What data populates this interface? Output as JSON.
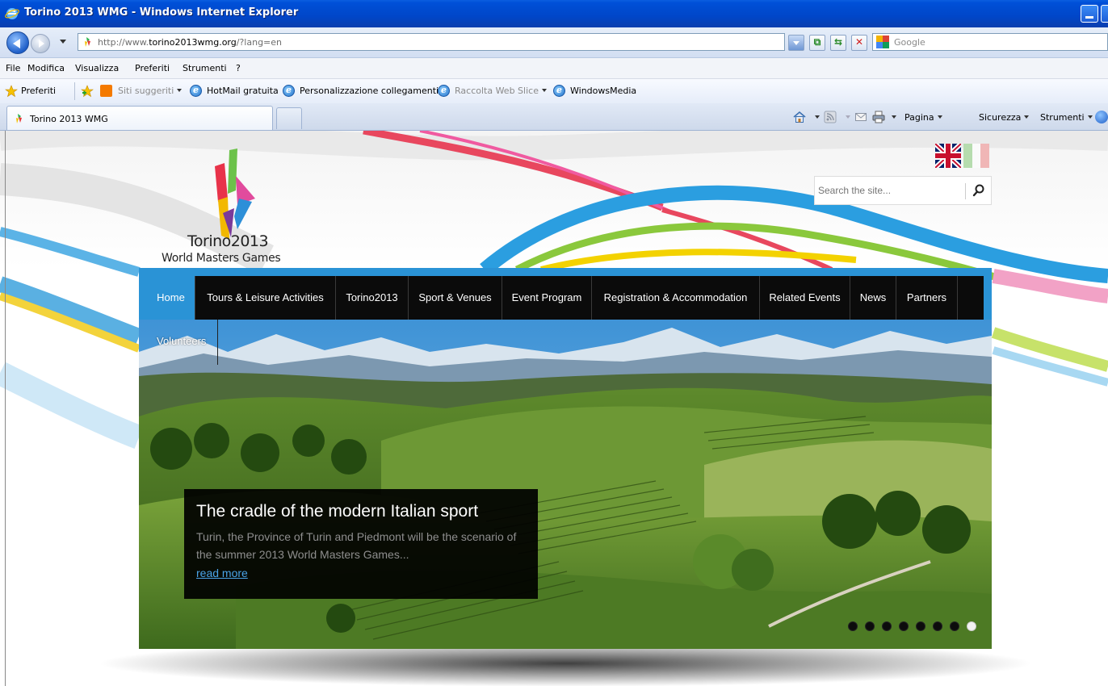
{
  "window": {
    "title": "Torino 2013 WMG - Windows Internet Explorer"
  },
  "address": {
    "url_prefix": "http://www.",
    "url_domain": "torino2013wmg.org",
    "url_suffix": "/?lang=en",
    "search_placeholder": "Google"
  },
  "menu": {
    "items": [
      "File",
      "Modifica",
      "Visualizza",
      "Preferiti",
      "Strumenti",
      "?"
    ]
  },
  "favorites": {
    "label": "Preferiti",
    "items": [
      {
        "label": "Siti suggeriti",
        "dimmed": true
      },
      {
        "label": "HotMail gratuita",
        "dimmed": false
      },
      {
        "label": "Personalizzazione collegamenti",
        "dimmed": false
      },
      {
        "label": "Raccolta Web Slice",
        "dimmed": true
      },
      {
        "label": "WindowsMedia",
        "dimmed": false
      }
    ]
  },
  "tabs": {
    "active_label": "Torino 2013 WMG"
  },
  "command_bar": {
    "page": "Pagina",
    "security": "Sicurezza",
    "tools": "Strumenti"
  },
  "site": {
    "logo_line1": "Torino2013",
    "logo_line2": "World Masters Games",
    "search_placeholder": "Search the site...",
    "nav": [
      {
        "label": "Home",
        "active": true
      },
      {
        "label": "Tours & Leisure Activities"
      },
      {
        "label": "Torino2013"
      },
      {
        "label": "Sport & Venues"
      },
      {
        "label": "Event Program"
      },
      {
        "label": "Registration & Accommodation"
      },
      {
        "label": "Related Events"
      },
      {
        "label": "News"
      },
      {
        "label": "Partners"
      }
    ],
    "nav_overflow": "Volunteers",
    "slide": {
      "title": "The cradle of the modern Italian sport",
      "text": "Turin, the Province of Turin and Piedmont will be the scenario of the summer 2013 World Masters Games...",
      "link": "read more"
    },
    "slider_count": 8,
    "slider_active": 8
  },
  "colors": {
    "nav_active": "#2a93d6",
    "title_bar": "#0050d8",
    "caption_link": "#4aa3e8"
  },
  "icons": [
    "ie-logo",
    "back-arrow-icon",
    "forward-arrow-icon",
    "favicon",
    "compat-view-icon",
    "refresh-icon",
    "stop-icon",
    "google-icon",
    "star-icon",
    "add-favorite-icon",
    "suggested-sites-icon",
    "home-icon",
    "rss-icon",
    "mail-icon",
    "print-icon",
    "help-icon",
    "flag-uk-icon",
    "flag-it-icon",
    "search-icon"
  ]
}
